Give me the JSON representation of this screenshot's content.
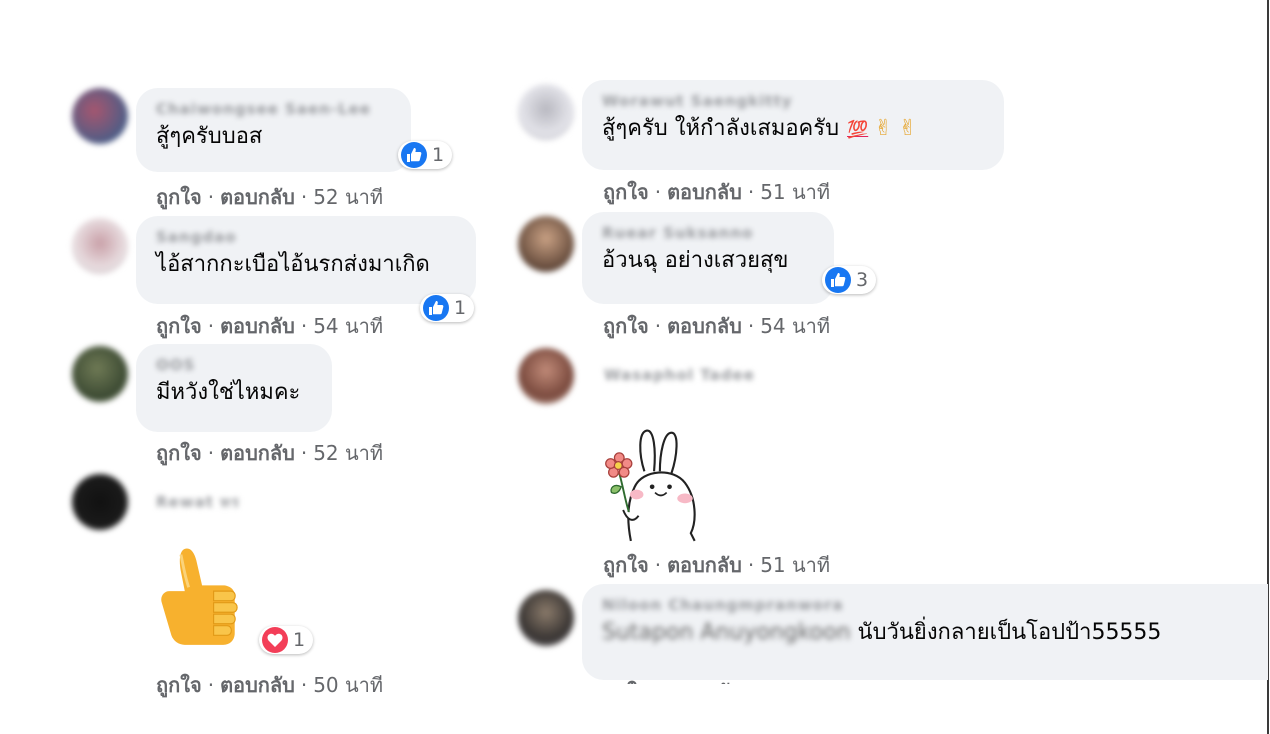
{
  "actions": {
    "like": "ถูกใจ",
    "reply": "ตอบกลับ",
    "sep": "·"
  },
  "comments_left": [
    {
      "name": "Chaiwongsee Saen-Lee",
      "text": "สู้ๆครับบอส",
      "reaction": "like",
      "count": "1",
      "time": "52 นาที"
    },
    {
      "name": "Sangdao",
      "text": "ไอ้สากกะเบือไอ้นรกส่งมาเกิด",
      "reaction": "like",
      "count": "1",
      "time": "54 นาที"
    },
    {
      "name": "OOS",
      "text": "มีหวังใช่ไหมคะ",
      "time": "52 นาที"
    },
    {
      "name": "Rewat ทร",
      "sticker": "thumbs-up",
      "reaction": "love",
      "count": "1",
      "time": "50 นาที"
    }
  ],
  "comments_right": [
    {
      "name": "Worawut Saengkitty",
      "text": "สู้ๆครับ ให้กำลังเสมอครับ",
      "emoji_100": "💯",
      "emoji_peace": "✌",
      "time": "51 นาที"
    },
    {
      "name": "Ruear Suksanno",
      "text": "อ้วนฉุ อย่างเสวยสุข",
      "reaction": "like",
      "count": "3",
      "time": "54 นาที"
    },
    {
      "name": "Wasaphol Tadee",
      "sticker": "bunny-with-flower",
      "time": "51 นาที"
    },
    {
      "name": "Niloon Chaungmpranwora",
      "tag": "Sutapon Anuyongkoon",
      "text": "นับวันยิ่งกลายเป็นโอปป้า55555"
    }
  ],
  "colors": {
    "like_blue": "#1877f2",
    "love_red": "#f33e58",
    "bubble_bg": "#f0f2f5",
    "meta_gray": "#65676b"
  }
}
